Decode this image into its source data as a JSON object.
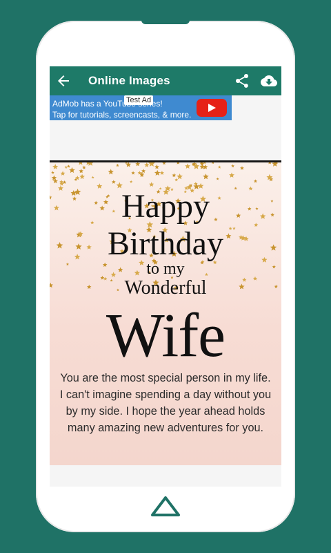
{
  "appbar": {
    "title": "Online Images",
    "back_icon": "arrow-back-icon",
    "share_icon": "share-icon",
    "download_icon": "cloud-download-icon",
    "color": "#1e7a68"
  },
  "ad": {
    "line1": "AdMob has a YouTube series!",
    "line2": "Tap for tutorials, screencasts, & more.",
    "test_label": "Test Ad",
    "play_icon": "youtube-play-icon",
    "color": "#3f8ad0"
  },
  "card": {
    "line_happy": "Happy",
    "line_birthday": "Birthday",
    "line_to_my": "to my",
    "line_wonderful": "Wonderful",
    "line_wife": "Wife",
    "message": "You are the most special person in my life. I can't imagine spending a day without you by my side. I hope the year ahead holds many amazing new adventures for you."
  },
  "device": {
    "home_icon": "home-icon",
    "background": "#1f7266"
  }
}
